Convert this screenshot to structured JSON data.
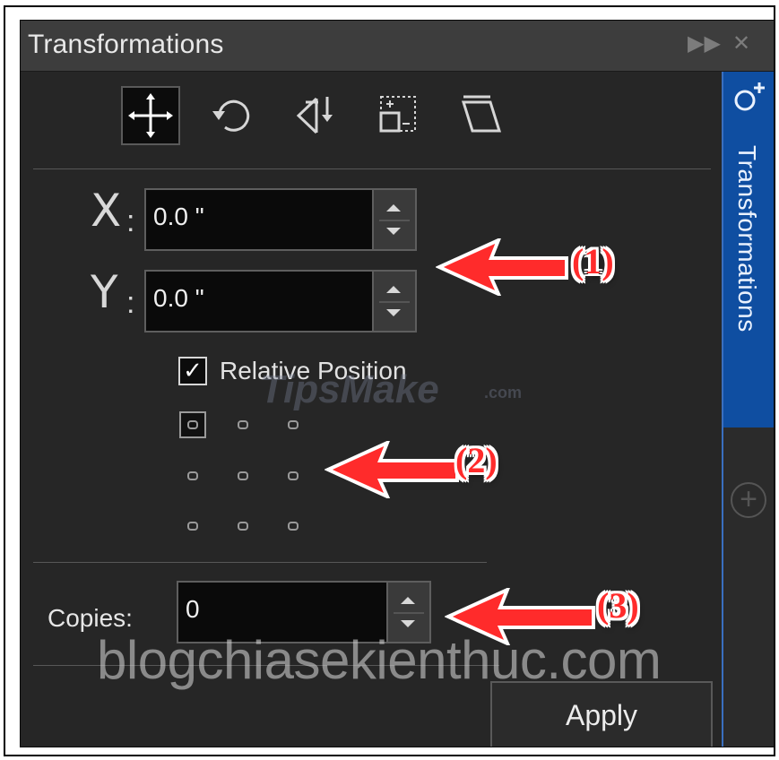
{
  "panel": {
    "title": "Transformations",
    "title_buttons": [
      "expand-icon",
      "close-icon"
    ]
  },
  "toolbar": {
    "tools": [
      {
        "name": "position-tool",
        "icon": "move-cross-icon",
        "active": true
      },
      {
        "name": "rotate-tool",
        "icon": "rotate-icon",
        "active": false
      },
      {
        "name": "scale-mirror-tool",
        "icon": "mirror-icon",
        "active": false
      },
      {
        "name": "size-tool",
        "icon": "size-icon",
        "active": false
      },
      {
        "name": "skew-tool",
        "icon": "skew-icon",
        "active": false
      }
    ]
  },
  "position": {
    "x_label": "X",
    "x_colon": ":",
    "x_value": "0.0 \"",
    "y_label": "Y",
    "y_colon": ":",
    "y_value": "0.0 \""
  },
  "relative": {
    "label": "Relative Position",
    "checked": true
  },
  "anchor_grid": {
    "rows": 3,
    "cols": 3,
    "selected": "top-left"
  },
  "copies": {
    "label": "Copies:",
    "value": "0"
  },
  "apply_label": "Apply",
  "sidebar": {
    "tab_label": "Transformations",
    "add_icon": "plus-circle-icon"
  },
  "annotations": {
    "callout_1": "(1)",
    "callout_2": "(2)",
    "callout_3": "(3)",
    "arrow_color": "#ff2b2b"
  },
  "watermarks": {
    "tips": "TipsMake",
    "tips_suffix": ".com",
    "blog": "blogchiasekienthuc.com"
  },
  "colors": {
    "panel_bg": "#262626",
    "titlebar_bg": "#3d3d3d",
    "sidebar_tab": "#0f4ea1",
    "field_bg": "#0a0a0a"
  }
}
